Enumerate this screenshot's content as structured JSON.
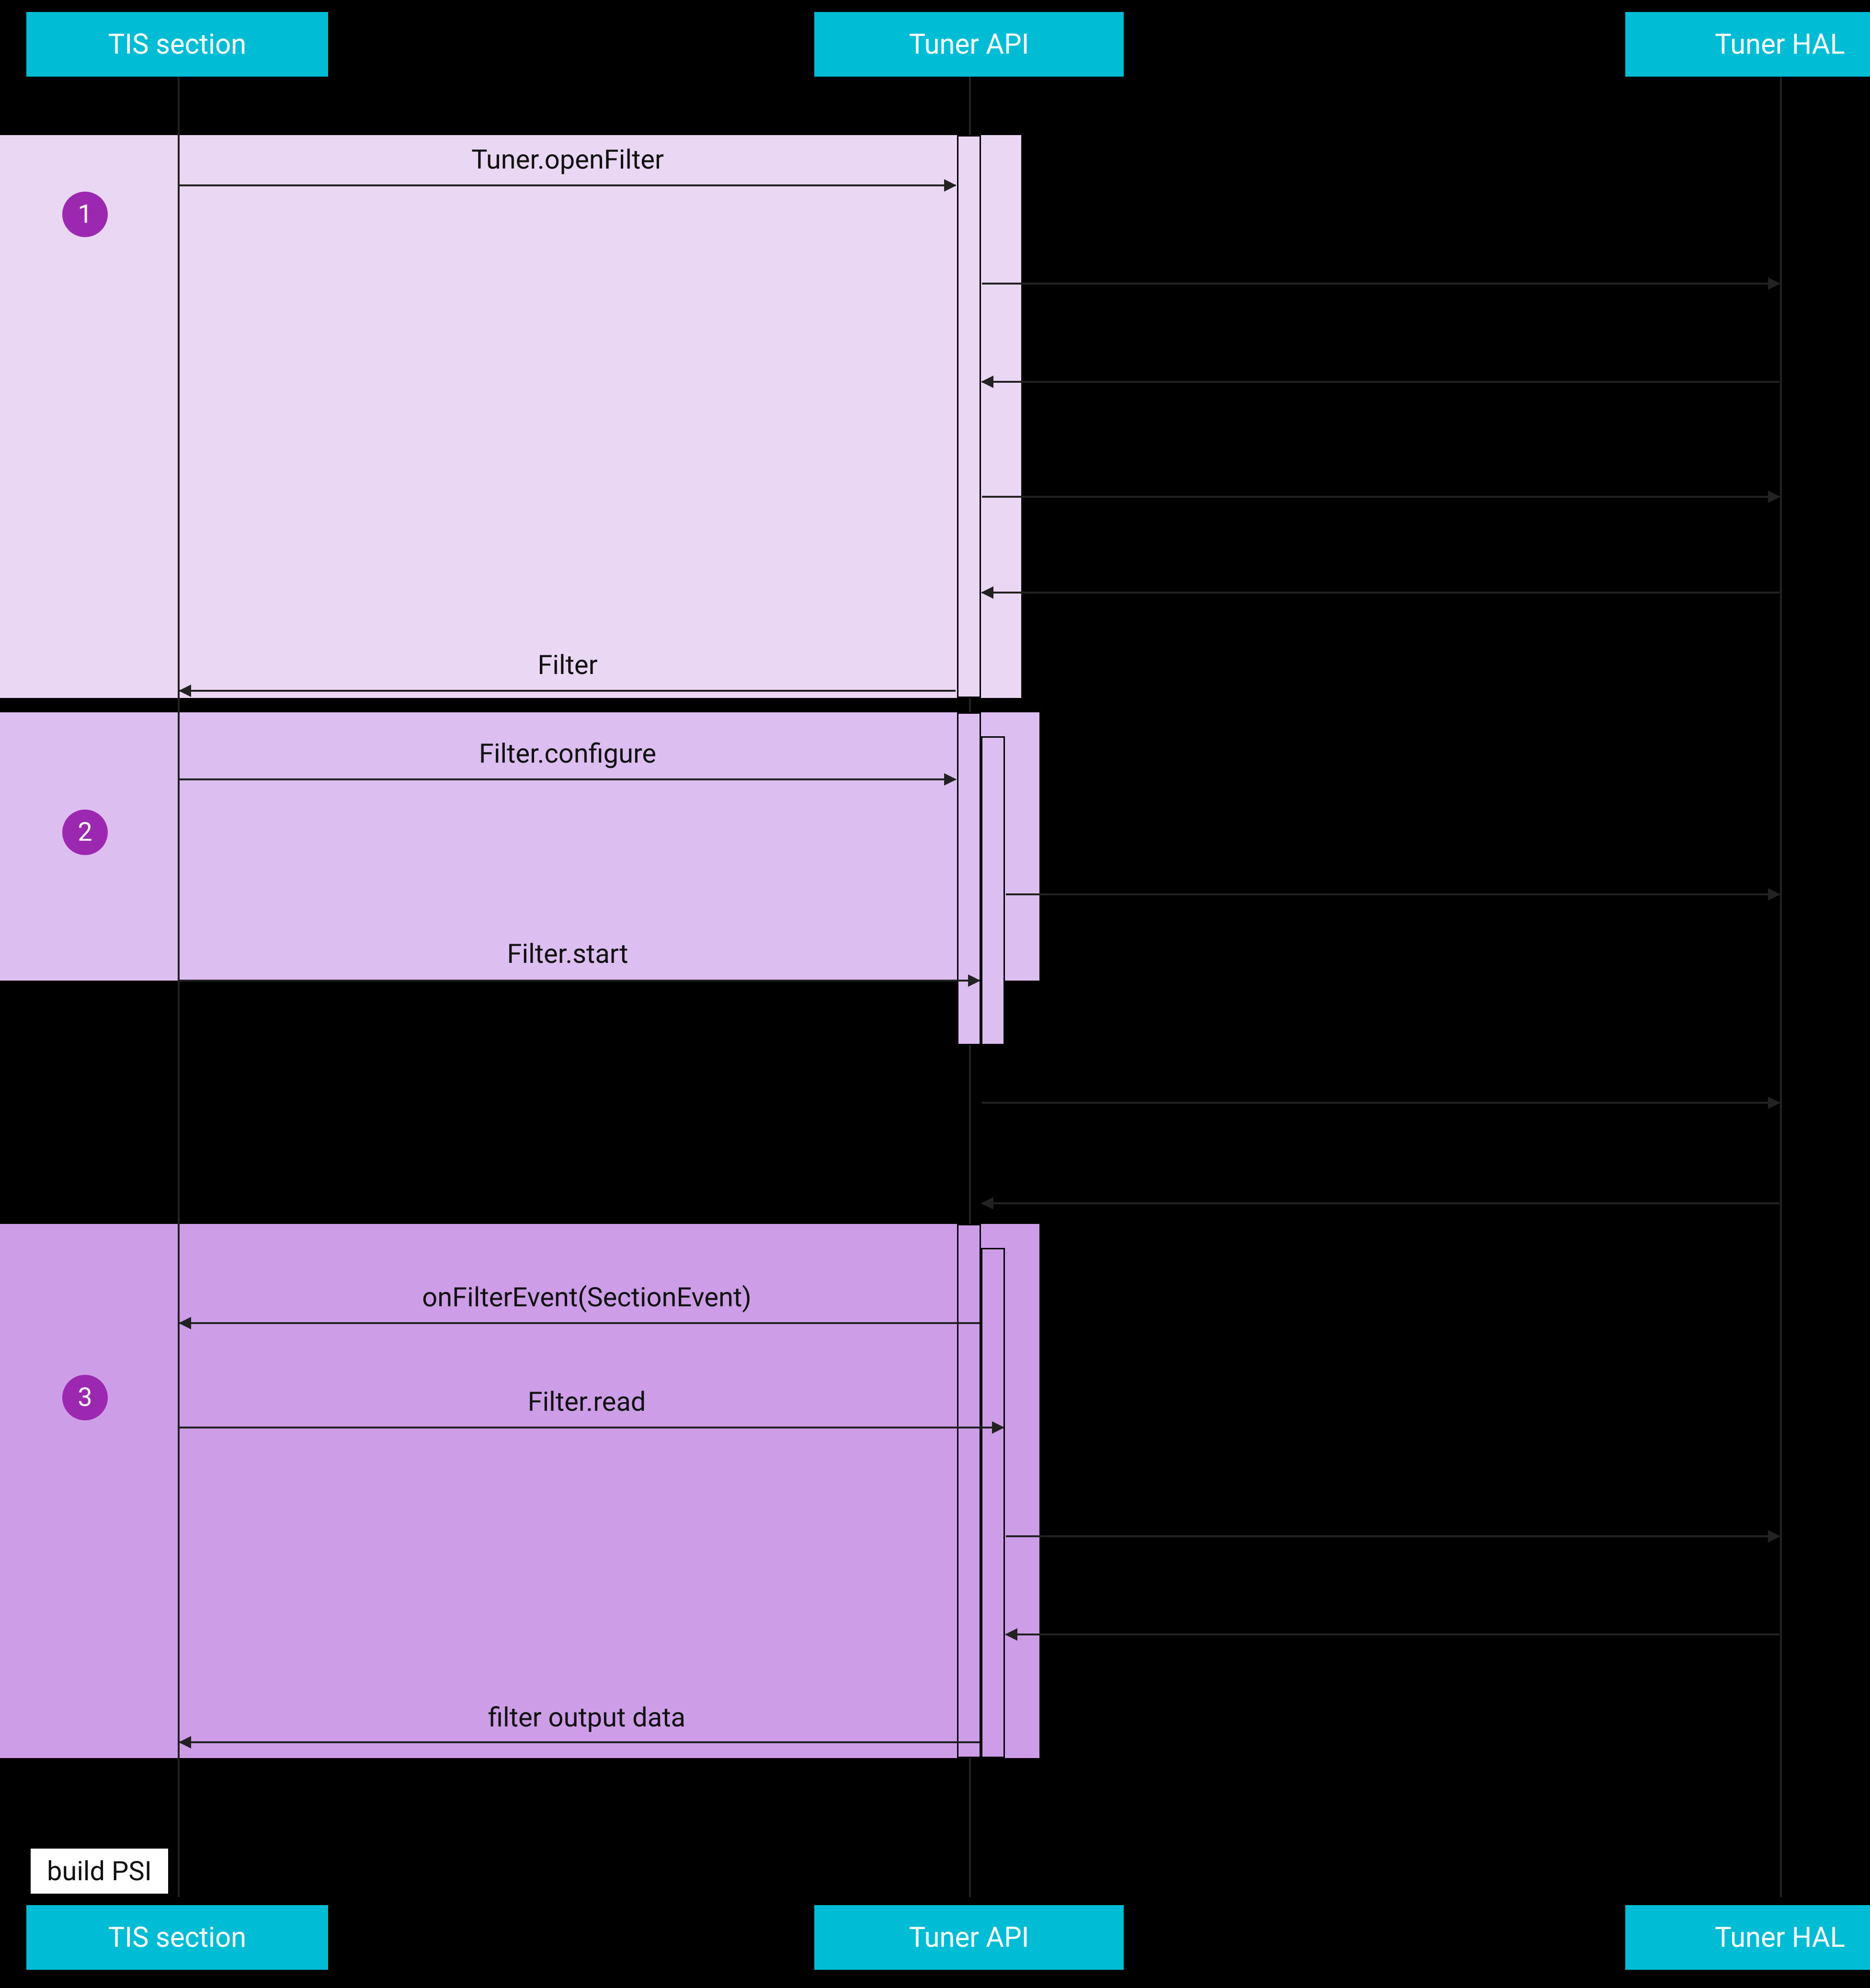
{
  "participants": {
    "tis": {
      "label": "TIS section"
    },
    "api": {
      "label": "Tuner API"
    },
    "hal": {
      "label": "Tuner HAL"
    }
  },
  "steps": {
    "s1": "1",
    "s2": "2",
    "s3": "3"
  },
  "messages": {
    "openFilter": "Tuner.openFilter",
    "filterReturn": "Filter",
    "filterConfigure": "Filter.configure",
    "filterStart": "Filter.start",
    "onFilterEvent": "onFilterEvent(SectionEvent)",
    "filterRead": "Filter.read",
    "filterOutputData": "filter output data"
  },
  "note": {
    "buildPsi": "build PSI"
  },
  "colors": {
    "participant": "#00bcd4",
    "badge": "#9c27b0",
    "phase1": "#e9d7f4",
    "phase2": "#dcbef0",
    "phase3": "#ce9de8"
  }
}
